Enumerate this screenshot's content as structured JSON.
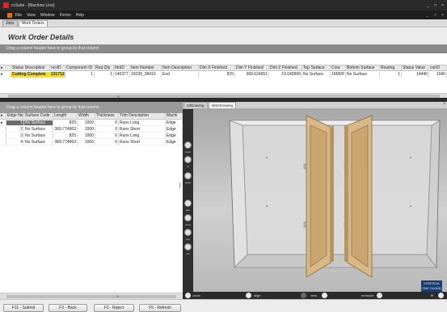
{
  "window": {
    "title": "ccSuite - [Machine Line]",
    "controls": [
      "_",
      "□",
      "×"
    ]
  },
  "menu": {
    "items": [
      "File",
      "View",
      "Window",
      "Forms",
      "Help"
    ],
    "controls": [
      "_",
      "↗",
      "×"
    ]
  },
  "tabs": {
    "items": [
      "Jobs",
      "Work Orders"
    ]
  },
  "page": {
    "title": "Work Order Details"
  },
  "work_order_grid": {
    "group_hint": "Drag a column header here to group by that column",
    "columns": [
      "Status Description",
      "ncvID",
      "Component ID",
      "Req Qty",
      "ItmID",
      "Item Number",
      "Item Description",
      "Dim X Finished",
      "Dim Y Finished",
      "Dim Z Finished",
      "Top Surface",
      "Core",
      "Bottom Surface",
      "Routing",
      "Status Value",
      "corID"
    ],
    "row": [
      "Cutting Complete",
      "131712",
      "1",
      "1",
      "140377",
      "15039_38410",
      "End",
      "825",
      "369.624951",
      "19.049999",
      "No Surface",
      "16MDF",
      "No Surface",
      "1",
      "14440",
      "1040"
    ]
  },
  "edge_grid": {
    "group_hint": "Drag a column header here to group by that column",
    "columns": [
      "Edge No",
      "Surface Code",
      "Length",
      "Width",
      "Thickness",
      "Trim Description",
      "Machi"
    ],
    "rows": [
      [
        "1",
        "No Surface",
        "825",
        "1000",
        "0",
        "Runs Long",
        "Edge"
      ],
      [
        "2",
        "No Surface",
        "369.774963",
        "1000",
        "0",
        "Runs Short",
        "Edge"
      ],
      [
        "3",
        "No Surface",
        "825",
        "1000",
        "0",
        "Runs Long",
        "Edge"
      ],
      [
        "4",
        "No Surface",
        "369.774963",
        "1000",
        "0",
        "Runs Short",
        "Edge"
      ]
    ]
  },
  "drawing": {
    "tabs": [
      "2dDrawing",
      "3dImDrawing"
    ],
    "side_tools": [
      "zoom",
      "fit",
      "study",
      "pan",
      "pivot",
      "turn",
      "roll"
    ],
    "bottom_tools": [
      "zoom",
      "align",
      "view",
      "measure",
      "fit"
    ],
    "logo_lines": [
      "CORTEXA",
      "CNC CLOUD"
    ]
  },
  "actions": {
    "buttons": [
      "F11 - Submit",
      "F2 - Back",
      "F3 - Reject",
      "F5 - Refresh"
    ]
  },
  "colors": {
    "selected_row": "#f5e01a",
    "door_wood": "#d8b887",
    "cabinet_glass": "#e2e2e2"
  }
}
